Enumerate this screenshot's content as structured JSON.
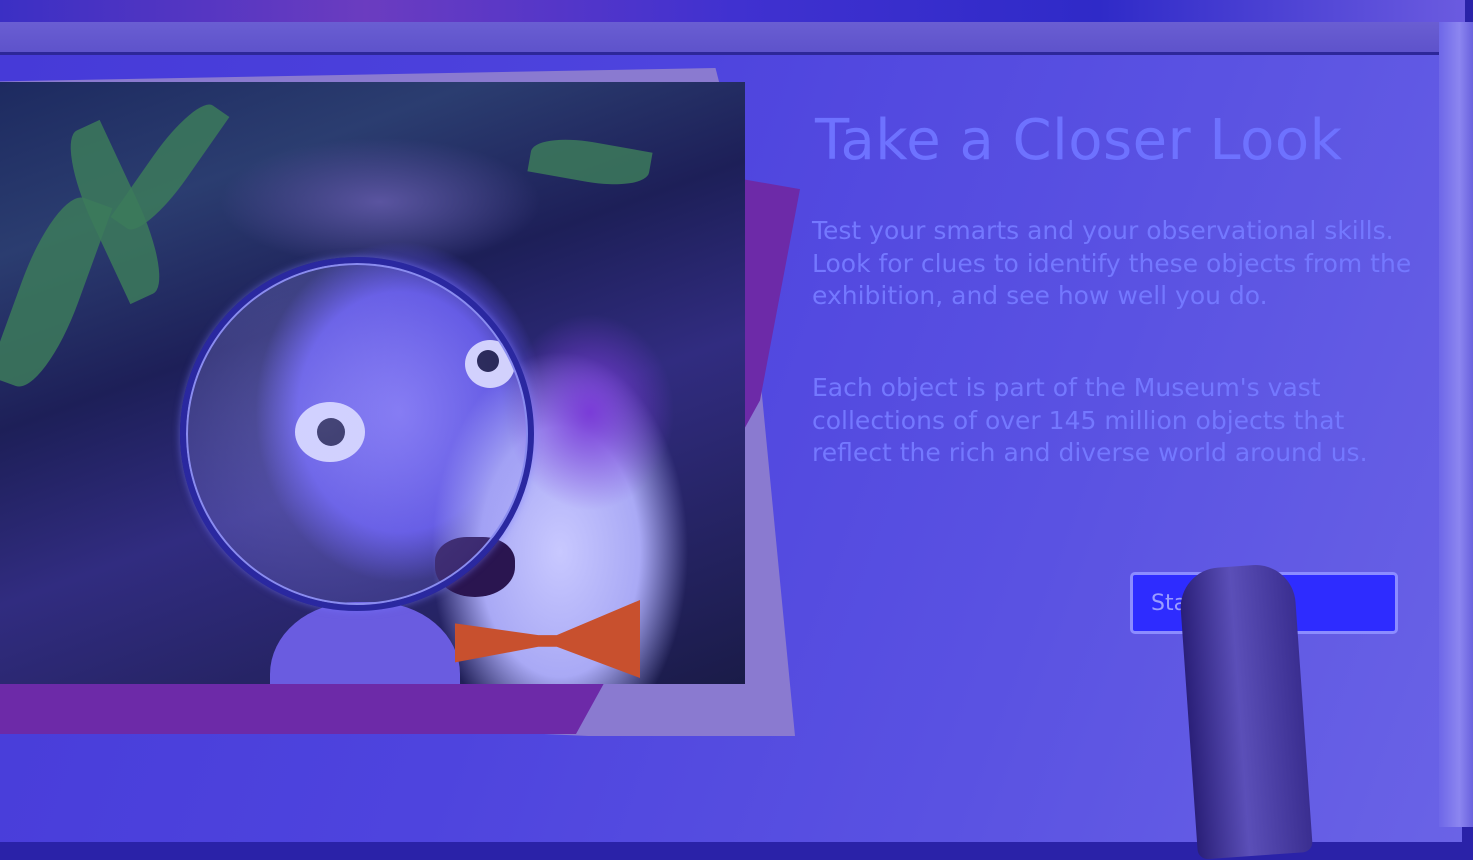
{
  "screen": {
    "title": "Take a Closer Look",
    "paragraphs": [
      "Test your smarts and your observational skills. Look for clues to identify these objects from the exhibition, and see how well you do.",
      "Each object is part of the Museum's vast collections of over 145 million objects that reflect the rich and diverse world around us."
    ],
    "start_button_label": "Start Quiz"
  },
  "colors": {
    "title": "#6e72ff",
    "button_fill": "#2e2cff",
    "panel_bg": "#4e44de"
  }
}
